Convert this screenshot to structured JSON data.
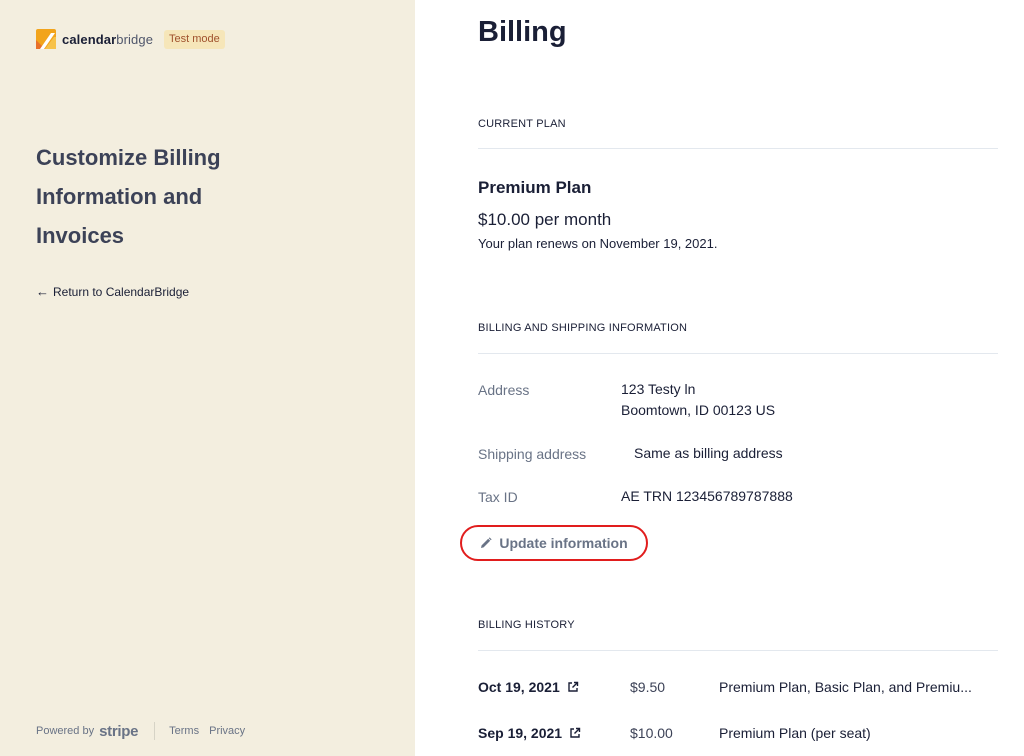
{
  "sidebar": {
    "brand": {
      "name_bold": "calendar",
      "name_light": "bridge",
      "badge": "Test mode"
    },
    "title": "Customize Billing Information and Invoices",
    "return_link": {
      "arrow": "←",
      "label": "Return to CalendarBridge"
    },
    "footer": {
      "powered_by": "Powered by",
      "stripe": "stripe",
      "terms": "Terms",
      "privacy": "Privacy"
    }
  },
  "main": {
    "title": "Billing",
    "current_plan": {
      "label": "CURRENT PLAN",
      "plan_name": "Premium Plan",
      "price": "$10.00 per month",
      "renewal": "Your plan renews on November 19, 2021."
    },
    "billing_info": {
      "label": "BILLING AND SHIPPING INFORMATION",
      "address_label": "Address",
      "address_line1": "123 Testy ln",
      "address_line2": "Boomtown, ID 00123 US",
      "shipping_label": "Shipping address",
      "shipping_value": "Same as billing address",
      "tax_label": "Tax ID",
      "tax_value": "AE TRN 123456789787888",
      "update_label": "Update information"
    },
    "billing_history": {
      "label": "BILLING HISTORY",
      "rows": [
        {
          "date": "Oct 19, 2021",
          "amount": "$9.50",
          "description": "Premium Plan, Basic Plan, and Premiu..."
        },
        {
          "date": "Sep 19, 2021",
          "amount": "$10.00",
          "description": "Premium Plan (per seat)"
        }
      ]
    }
  },
  "colors": {
    "sidebar_bg": "#f3eedf",
    "badge_bg": "#f6e6b9",
    "badge_text": "#a0522d",
    "highlight_ring": "#e11d1d"
  },
  "icons": [
    "calendarbridge-logo-icon",
    "arrow-left-icon",
    "pencil-icon",
    "external-link-icon"
  ]
}
